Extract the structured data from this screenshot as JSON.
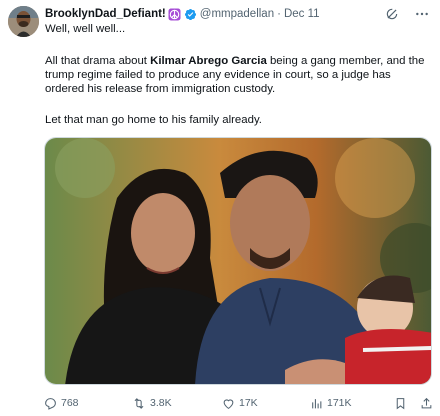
{
  "author": {
    "display_name": "BrooklynDad_Defiant!",
    "handle": "@mmpadellan",
    "separator": "·",
    "date": "Dec 11",
    "badge_icon": "peace-sign-icon",
    "verified_icon": "verified-badge-icon"
  },
  "tweet": {
    "line1": "Well, well well...",
    "para1_before": "All that drama about ",
    "para1_bold": "Kilmar Abrego Garcia",
    "para1_after": " being a gang member, and the trump regime failed to produce any evidence in court, so a judge has ordered his release from immigration custody.",
    "para2": "Let that man go home to his family already."
  },
  "actions": {
    "replies": "768",
    "retweets": "3.8K",
    "likes": "17K",
    "views": "171K"
  },
  "colors": {
    "accent": "#1d9bf0",
    "muted": "#536471",
    "badge": "#a64dd6"
  }
}
